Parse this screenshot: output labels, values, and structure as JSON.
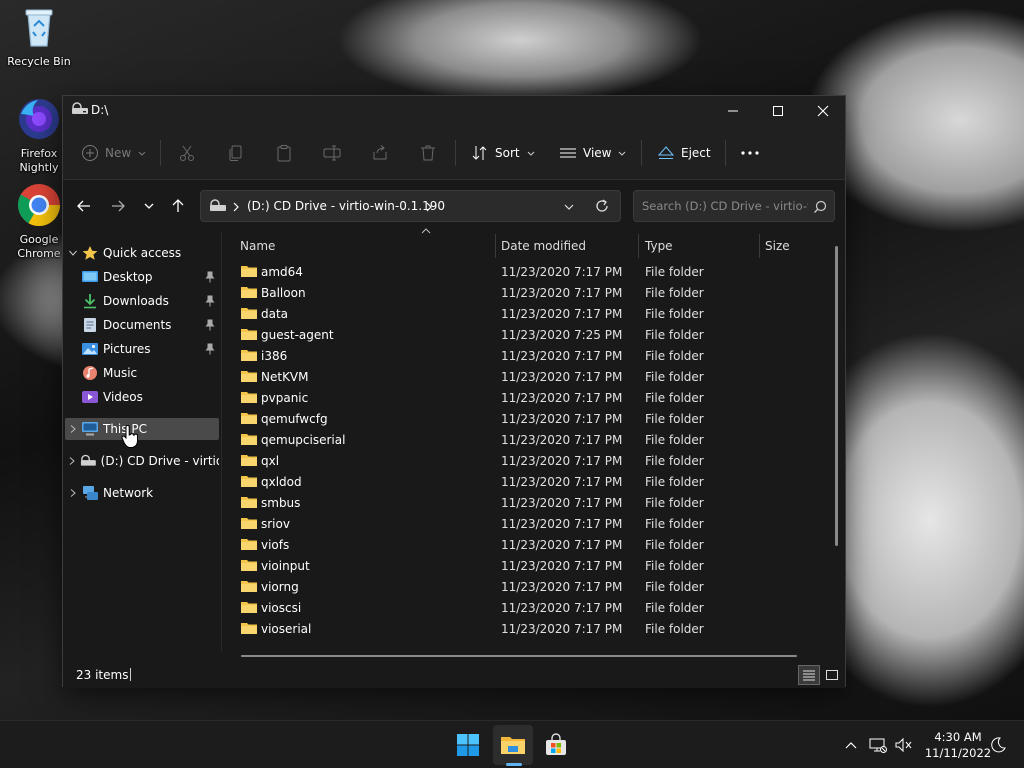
{
  "desktop": {
    "icons": [
      {
        "label": "Recycle Bin"
      },
      {
        "label_line1": "Firefox",
        "label_line2": "Nightly"
      },
      {
        "label_line1": "Google",
        "label_line2": "Chrome"
      }
    ]
  },
  "window": {
    "title": "D:\\",
    "command_bar": {
      "new_label": "New",
      "sort_label": "Sort",
      "view_label": "View",
      "eject_label": "Eject"
    },
    "address": {
      "path": "(D:) CD Drive - virtio-win-0.1.190",
      "search_placeholder": "Search (D:) CD Drive - virtio-w..."
    },
    "sidebar": {
      "quick_access": "Quick access",
      "items": [
        {
          "label": "Desktop",
          "icon": "desktop-icon",
          "pinned": true
        },
        {
          "label": "Downloads",
          "icon": "downloads-icon",
          "pinned": true
        },
        {
          "label": "Documents",
          "icon": "documents-icon",
          "pinned": true
        },
        {
          "label": "Pictures",
          "icon": "pictures-icon",
          "pinned": true
        },
        {
          "label": "Music",
          "icon": "music-icon",
          "pinned": false
        },
        {
          "label": "Videos",
          "icon": "videos-icon",
          "pinned": false
        }
      ],
      "this_pc": "This PC",
      "cd_drive": "(D:) CD Drive - virtio-",
      "network": "Network"
    },
    "columns": {
      "name": "Name",
      "date_modified": "Date modified",
      "type": "Type",
      "size": "Size"
    },
    "files": [
      {
        "name": "amd64",
        "date": "11/23/2020 7:17 PM",
        "type": "File folder"
      },
      {
        "name": "Balloon",
        "date": "11/23/2020 7:17 PM",
        "type": "File folder"
      },
      {
        "name": "data",
        "date": "11/23/2020 7:17 PM",
        "type": "File folder"
      },
      {
        "name": "guest-agent",
        "date": "11/23/2020 7:25 PM",
        "type": "File folder"
      },
      {
        "name": "i386",
        "date": "11/23/2020 7:17 PM",
        "type": "File folder"
      },
      {
        "name": "NetKVM",
        "date": "11/23/2020 7:17 PM",
        "type": "File folder"
      },
      {
        "name": "pvpanic",
        "date": "11/23/2020 7:17 PM",
        "type": "File folder"
      },
      {
        "name": "qemufwcfg",
        "date": "11/23/2020 7:17 PM",
        "type": "File folder"
      },
      {
        "name": "qemupciserial",
        "date": "11/23/2020 7:17 PM",
        "type": "File folder"
      },
      {
        "name": "qxl",
        "date": "11/23/2020 7:17 PM",
        "type": "File folder"
      },
      {
        "name": "qxldod",
        "date": "11/23/2020 7:17 PM",
        "type": "File folder"
      },
      {
        "name": "smbus",
        "date": "11/23/2020 7:17 PM",
        "type": "File folder"
      },
      {
        "name": "sriov",
        "date": "11/23/2020 7:17 PM",
        "type": "File folder"
      },
      {
        "name": "viofs",
        "date": "11/23/2020 7:17 PM",
        "type": "File folder"
      },
      {
        "name": "vioinput",
        "date": "11/23/2020 7:17 PM",
        "type": "File folder"
      },
      {
        "name": "viorng",
        "date": "11/23/2020 7:17 PM",
        "type": "File folder"
      },
      {
        "name": "vioscsi",
        "date": "11/23/2020 7:17 PM",
        "type": "File folder"
      },
      {
        "name": "vioserial",
        "date": "11/23/2020 7:17 PM",
        "type": "File folder"
      }
    ],
    "status": "23 items"
  },
  "taskbar": {
    "time": "4:30 AM",
    "date": "11/11/2022"
  },
  "colors": {
    "folder": "#f3c649",
    "accent": "#60b4f0",
    "window_bg": "#191919",
    "chrome_bg": "#202020"
  }
}
